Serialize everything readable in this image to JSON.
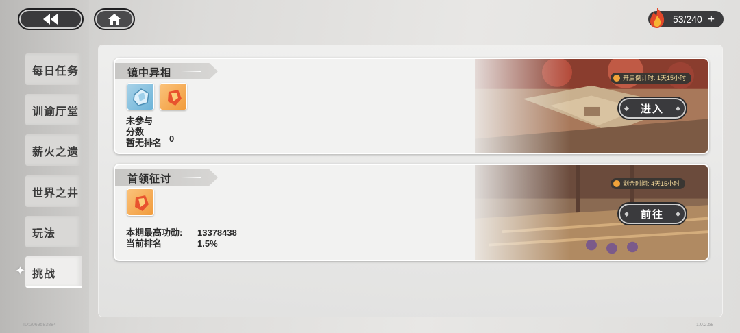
{
  "header": {
    "resource": {
      "amount": "53/240",
      "plus": "+",
      "icon": "flame-icon"
    }
  },
  "nav": [
    {
      "label": "每日任务",
      "active": false
    },
    {
      "label": "训谕厅堂",
      "active": false
    },
    {
      "label": "薪火之遗",
      "active": false
    },
    {
      "label": "世界之井",
      "active": false
    },
    {
      "label": "玩法",
      "active": false
    },
    {
      "label": "挑战",
      "active": true
    }
  ],
  "cards": [
    {
      "title": "镜中异相",
      "status_label": "未参与",
      "score_label": "分数",
      "rank_label": "暂无排名",
      "rank_value": "0",
      "timer": "开启倒计时: 1天15小时",
      "button": "进入"
    },
    {
      "title": "首领征讨",
      "best_label": "本期最高功勋:",
      "best_value": "13378438",
      "rank_label": "当前排名",
      "rank_value": "1.5%",
      "timer": "剩余时间: 4天15小时",
      "button": "前往"
    }
  ],
  "footer": {
    "id": "ID:2069583884",
    "version": "1.0.2.58"
  },
  "colors": {
    "accent": "#f0a33a",
    "button_dark": "#3a3a3d"
  }
}
